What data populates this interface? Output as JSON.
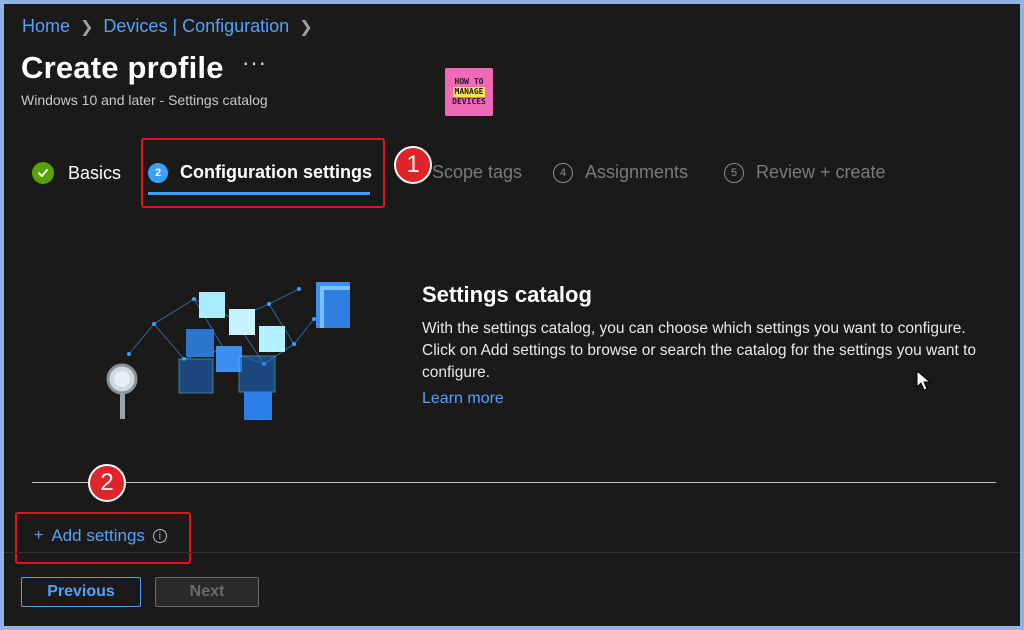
{
  "breadcrumb": {
    "items": [
      "Home",
      "Devices | Configuration"
    ],
    "separator": ">"
  },
  "header": {
    "title": "Create profile",
    "more_icon": "ellipsis-icon",
    "subtitle": "Windows 10 and later - Settings catalog"
  },
  "logo": {
    "line1": "HOW TO",
    "line2": "MANAGE",
    "line3": "DEVICES"
  },
  "steps": [
    {
      "number": "",
      "label": "Basics",
      "state": "completed",
      "icon": "check-circle-icon"
    },
    {
      "number": "2",
      "label": "Configuration settings",
      "state": "active"
    },
    {
      "number": "",
      "label": "Scope tags",
      "state": "upcoming"
    },
    {
      "number": "4",
      "label": "Assignments",
      "state": "upcoming"
    },
    {
      "number": "5",
      "label": "Review + create",
      "state": "upcoming"
    }
  ],
  "annotations": {
    "badge1": "1",
    "badge2": "2"
  },
  "catalog": {
    "title": "Settings catalog",
    "description": "With the settings catalog, you can choose which settings you want to configure. Click on Add settings to browse or search the catalog for the settings you want to configure.",
    "learn_more": "Learn more"
  },
  "add_settings": {
    "plus": "+",
    "label": "Add settings",
    "info": "i"
  },
  "footer": {
    "previous": "Previous",
    "next": "Next"
  },
  "colors": {
    "background": "#1b1a19",
    "accent": "#4da3ff",
    "highlight": "#e0141e",
    "success": "#57a300"
  }
}
